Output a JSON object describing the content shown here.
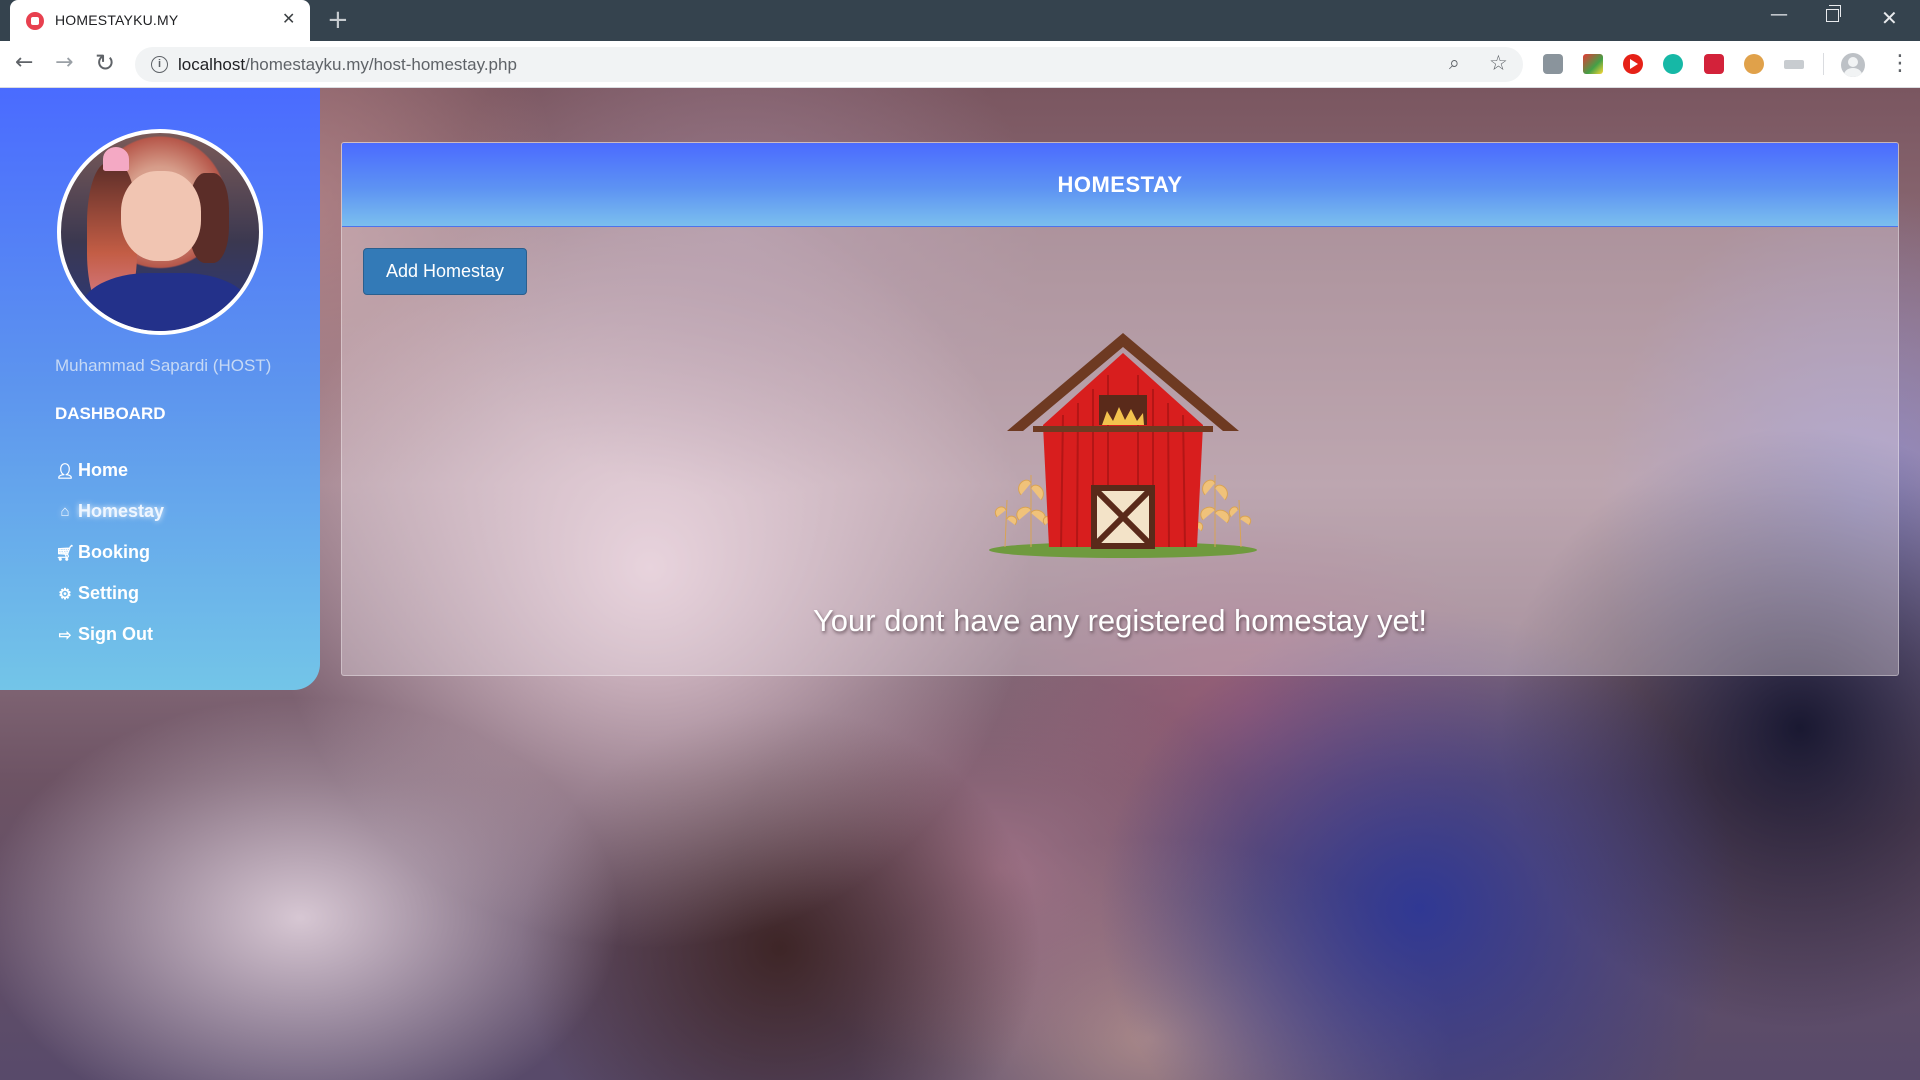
{
  "browser": {
    "tab_title": "HOMESTAYKU.MY",
    "tab_close_icon": "close-icon",
    "new_tab_icon": "plus-icon",
    "url_host": "localhost",
    "url_path": "/homestayku.my/host-homestay.php",
    "window_controls": [
      "minimize-icon",
      "restore-icon",
      "close-icon"
    ],
    "extensions": [
      "extension-icon-1",
      "extension-icon-2",
      "youtube-extension-icon",
      "teal-extension-icon",
      "red-extension-icon",
      "cookie-extension-icon",
      "grey-extension-icon"
    ]
  },
  "sidebar": {
    "user_name": "Muhammad Sapardi (HOST)",
    "section_title": "DASHBOARD",
    "items": [
      {
        "label": "Home",
        "icon": "user-icon"
      },
      {
        "label": "Homestay",
        "icon": "house-icon",
        "active": true
      },
      {
        "label": "Booking",
        "icon": "cart-icon"
      },
      {
        "label": "Setting",
        "icon": "gear-icon"
      },
      {
        "label": "Sign Out",
        "icon": "sign-out-icon"
      }
    ]
  },
  "main": {
    "title": "HOMESTAY",
    "add_button_label": "Add Homestay",
    "empty_message": "Your dont have any registered homestay yet!",
    "illustration": "barn-icon"
  },
  "colors": {
    "sidebar_top": "#4a6bff",
    "sidebar_bottom": "#73c5e8",
    "button": "#337ab7",
    "barn_red": "#d81e1e",
    "roof_brown": "#6e3a22"
  }
}
